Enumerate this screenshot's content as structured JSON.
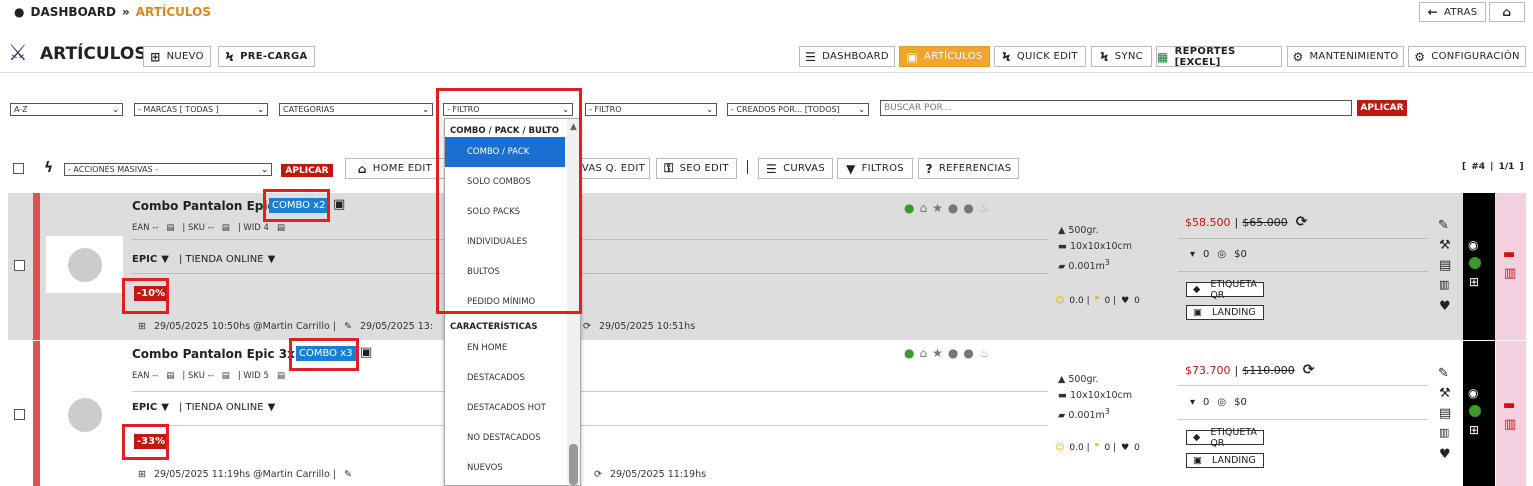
{
  "breadcrumb": {
    "root": "DASHBOARD",
    "sep": "»",
    "current": "ARTÍCULOS"
  },
  "top_buttons": {
    "atras": "ATRAS"
  },
  "page": {
    "title": "ARTÍCULOS",
    "nuevo": "NUEVO",
    "precarga": "PRE-CARGA"
  },
  "nav": {
    "dashboard": "DASHBOARD",
    "articulos": "ARTÍCULOS",
    "quick_edit": "QUICK EDIT",
    "sync": "SYNC",
    "reportes": "REPORTES [EXCEL]",
    "mantenimiento": "MANTENIMIENTO",
    "configuracion": "CONFIGURACIÓN"
  },
  "filters": {
    "sort": "A-Z",
    "marcas": "- MARCAS [ TODAS ]",
    "categorias": "CATEGORIAS",
    "filtro1": "- FILTRO",
    "filtro2": "- FILTRO",
    "creados": "- CREADOS POR... [TODOS]",
    "search_placeholder": "BUSCAR POR...",
    "aplicar": "APLICAR"
  },
  "actions": {
    "masivas": "- ACCIONES MASIVAS -",
    "aplicar": "APLICAR",
    "home_edit": "HOME EDIT",
    "curvas_q": "RVAS Q. EDIT",
    "seo_edit": "SEO EDIT",
    "curvas": "CURVAS",
    "filtros": "FILTROS",
    "referencias": "REFERENCIAS",
    "pagination": "[ #4 | 1/1 ]"
  },
  "dropdown": {
    "group1": "COMBO / PACK / BULTO",
    "items1": [
      "COMBO / PACK",
      "SOLO COMBOS",
      "SOLO PACKS",
      "INDIVIDUALES",
      "BULTOS",
      "PEDIDO MÍNIMO"
    ],
    "group2": "CARACTERÍSTICAS",
    "items2": [
      "EN HOME",
      "DESTACADOS",
      "DESTACADOS HOT",
      "NO DESTACADOS",
      "NUEVOS"
    ]
  },
  "products": [
    {
      "name": "Combo Pantalon Epic",
      "badge": "COMBO x2",
      "ean": "EAN --",
      "sku": "| SKU --",
      "wid": "| WID 4",
      "brand": "EPIC",
      "store": "| TIENDA ONLINE",
      "discount": "-10%",
      "created": "29/05/2025 10:50hs @Martin Carrillo |",
      "edited": "29/05/2025 13:",
      "synced": "29/05/2025 10:51hs",
      "weight": "500gr.",
      "dims": "10x10x10cm",
      "vol": "0.001m",
      "vol_exp": "3",
      "price": "$58.500",
      "old_price": "$65.000",
      "stock": "0",
      "stock_val": "$0",
      "rating": "0.0 |",
      "quotes": "0 |",
      "likes": "0",
      "etiqueta": "ETIQUETA QR",
      "landing": "LANDING"
    },
    {
      "name": "Combo Pantalon Epic 3x2",
      "badge": "COMBO x3",
      "ean": "EAN --",
      "sku": "| SKU --",
      "wid": "| WID 5",
      "brand": "EPIC",
      "store": "| TIENDA ONLINE",
      "discount": "-33%",
      "created": "29/05/2025 11:19hs @Martin Carrillo |",
      "edited": "",
      "synced": "29/05/2025 11:19hs",
      "weight": "500gr.",
      "dims": "10x10x10cm",
      "vol": "0.001m",
      "vol_exp": "3",
      "price": "$73.700",
      "old_price": "$110.000",
      "stock": "0",
      "stock_val": "$0",
      "rating": "0.0 |",
      "quotes": "0 |",
      "likes": "0",
      "etiqueta": "ETIQUETA QR",
      "landing": "LANDING"
    }
  ],
  "colors": {
    "accent": "#f0a52f",
    "red": "#c0180f",
    "badge": "#1a7fd0",
    "highlight": "#e02020"
  }
}
